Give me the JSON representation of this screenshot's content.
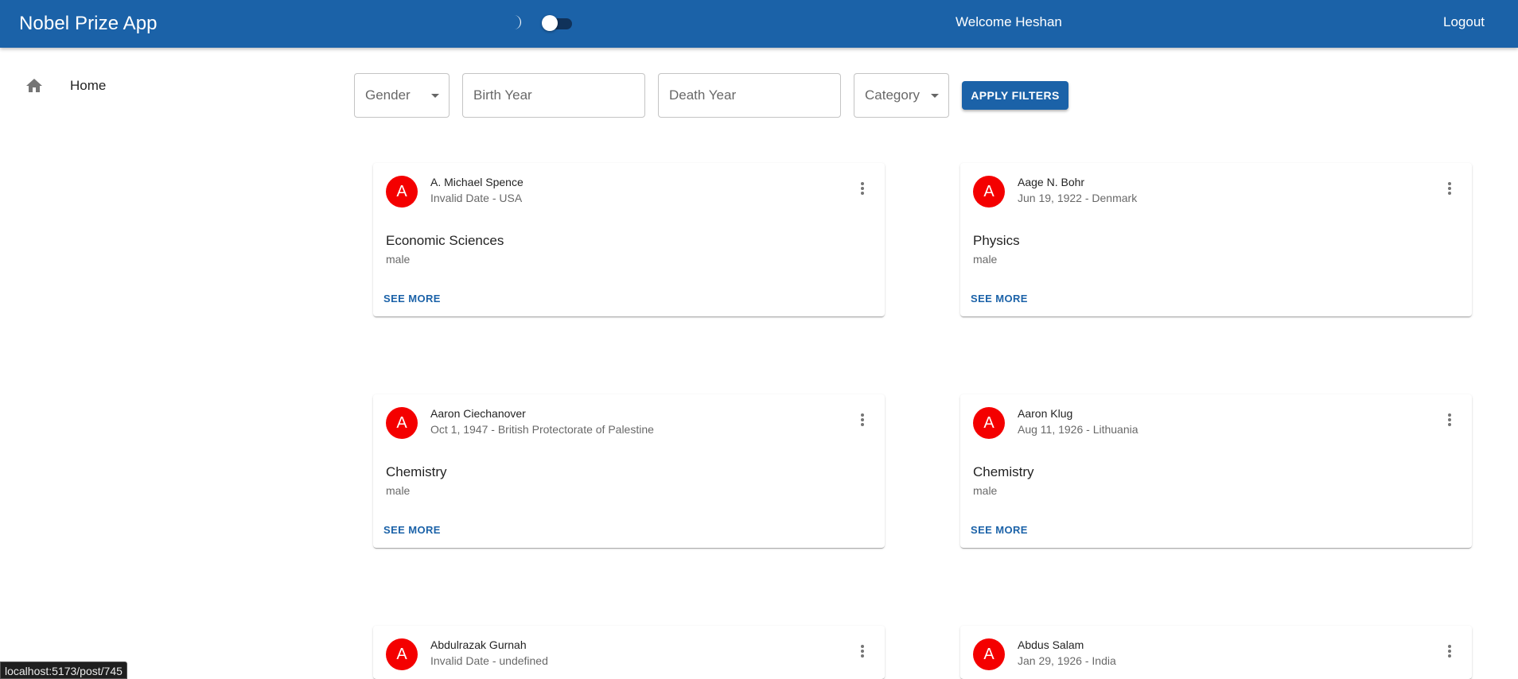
{
  "appbar": {
    "title": "Nobel Prize App",
    "welcome": "Welcome Heshan",
    "logout": "Logout",
    "brand_color": "#1b62a8",
    "theme_icon": "moon-icon"
  },
  "sidebar": {
    "home_label": "Home",
    "home_icon": "home-icon"
  },
  "filters": {
    "gender_label": "Gender",
    "birth_year_placeholder": "Birth Year",
    "death_year_placeholder": "Death Year",
    "category_label": "Category",
    "apply_label": "APPLY FILTERS"
  },
  "cards": [
    {
      "initial": "A",
      "name": "A. Michael Spence",
      "subtitle": "Invalid Date - USA",
      "category": "Economic Sciences",
      "gender": "male",
      "action": "SEE MORE"
    },
    {
      "initial": "A",
      "name": "Aage N. Bohr",
      "subtitle": "Jun 19, 1922 - Denmark",
      "category": "Physics",
      "gender": "male",
      "action": "SEE MORE"
    },
    {
      "initial": "A",
      "name": "Aaron Ciechanover",
      "subtitle": "Oct 1, 1947 - British Protectorate of Palestine",
      "category": "Chemistry",
      "gender": "male",
      "action": "SEE MORE"
    },
    {
      "initial": "A",
      "name": "Aaron Klug",
      "subtitle": "Aug 11, 1926 - Lithuania",
      "category": "Chemistry",
      "gender": "male",
      "action": "SEE MORE"
    },
    {
      "initial": "A",
      "name": "Abdulrazak Gurnah",
      "subtitle": "Invalid Date - undefined",
      "category": "",
      "gender": "",
      "action": ""
    },
    {
      "initial": "A",
      "name": "Abdus Salam",
      "subtitle": "Jan 29, 1926 - India",
      "category": "",
      "gender": "",
      "action": ""
    }
  ],
  "avatar_color": "#f40000",
  "status_bar": {
    "url": "localhost:5173/post/745"
  }
}
